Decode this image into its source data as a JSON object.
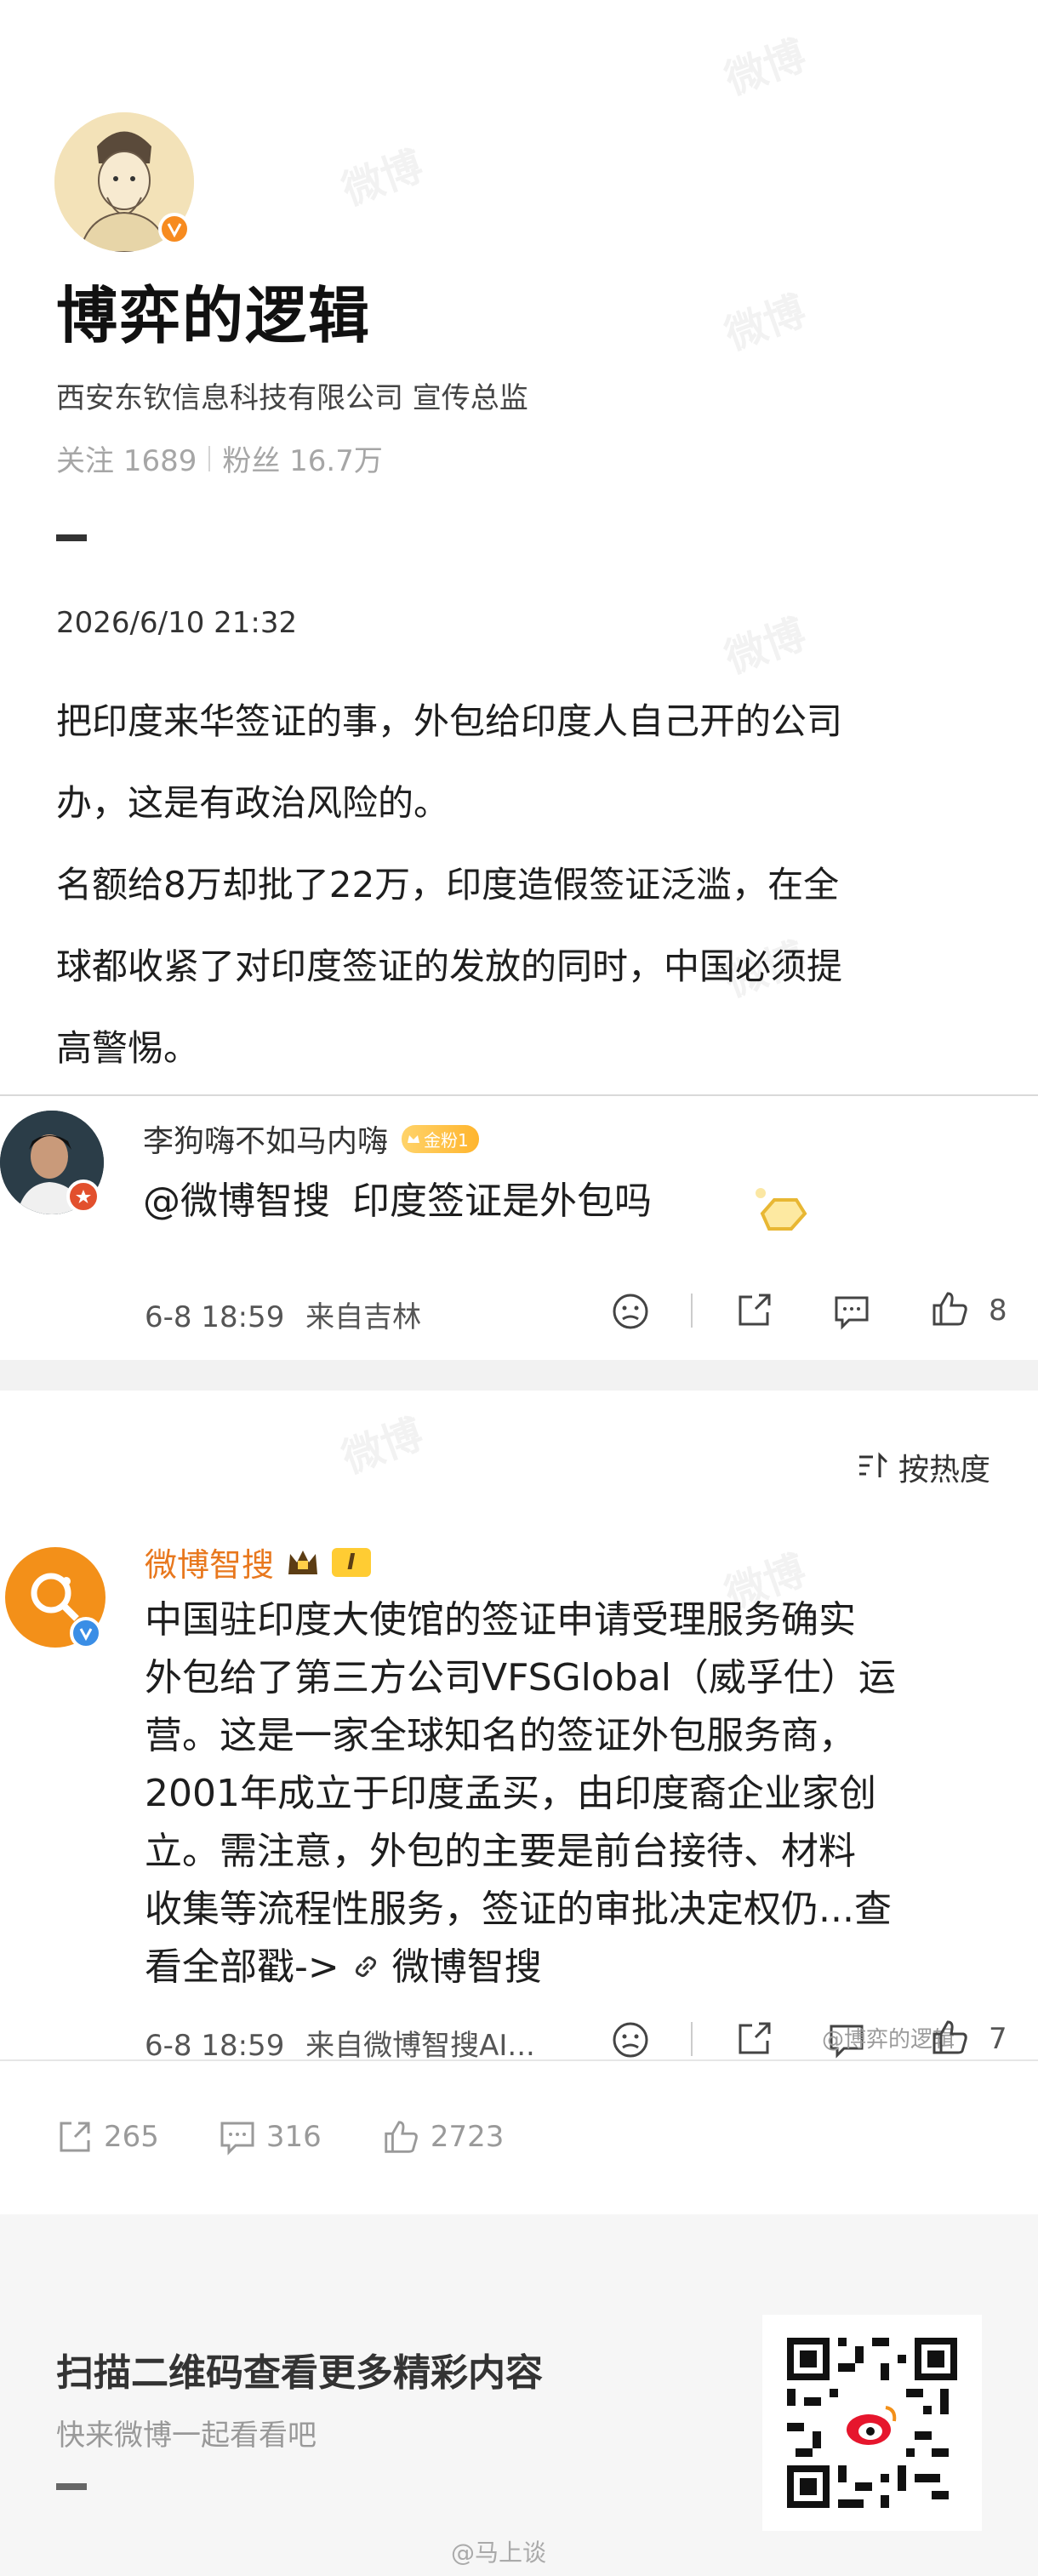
{
  "profile": {
    "name": "博弈的逻辑",
    "company": "西安东钦信息科技有限公司 宣传总监",
    "following_label": "关注",
    "following_count": "1689",
    "fans_label": "粉丝",
    "fans_count": "16.7万"
  },
  "post": {
    "timestamp": "2026/6/10 21:32",
    "lines": [
      "把印度来华签证的事，外包给印度人自己开的公司",
      "办，这是有政治风险的。",
      "名额给8万却批了22万，印度造假签证泛滥，在全",
      "球都收紧了对印度签证的发放的同时，中国必须提",
      "高警惕。"
    ]
  },
  "comment": {
    "user": "李狗嗨不如马内嗨",
    "fan_badge": "金粉1",
    "mention": "@微博智搜",
    "text": "印度签证是外包吗",
    "time": "6-8 18:59",
    "source": "来自吉林",
    "like_count": "8"
  },
  "reply": {
    "sort_label": "按热度",
    "user": "微博智搜",
    "level_badge": "I",
    "lines": [
      "中国驻印度大使馆的签证申请受理服务确实",
      "外包给了第三方公司VFSGlobal（威孚仕）运",
      "营。这是一家全球知名的签证外包服务商，",
      "2001年成立于印度孟买，由印度裔企业家创",
      "立。需注意，外包的主要是前台接待、材料",
      "收集等流程性服务，签证的审批决定权仍...查"
    ],
    "last_line_prefix": "看全部戳->",
    "link_text": "微博智搜",
    "time": "6-8 18:59",
    "source": "来自微博智搜AI...",
    "like_count": "7",
    "watermark": "@博弈的逻辑"
  },
  "footer_stats": {
    "reposts": "265",
    "comments": "316",
    "likes": "2723"
  },
  "qr": {
    "title": "扫描二维码查看更多精彩内容",
    "subtitle": "快来微博一起看看吧"
  },
  "bottom_watermark": "@马上谈",
  "colors": {
    "accent_orange": "#e8781e",
    "gray_text": "#a6a6a6",
    "badge_gold": "#ffb52e"
  }
}
